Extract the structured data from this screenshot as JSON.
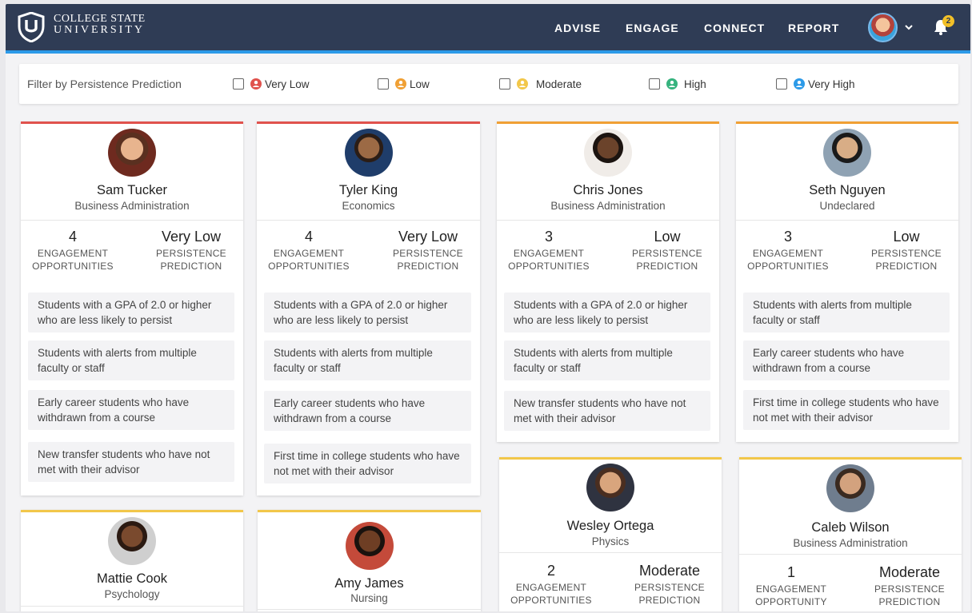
{
  "brand": {
    "line1": "COLLEGE STATE",
    "line2": "UNIVERSITY"
  },
  "nav": {
    "links": [
      "ADVISE",
      "ENGAGE",
      "CONNECT",
      "REPORT"
    ],
    "notification_count": "2"
  },
  "filter": {
    "label": "Filter by Persistence Prediction",
    "options": [
      {
        "label": "Very Low",
        "color": "#e0524d"
      },
      {
        "label": "Low",
        "color": "#f0a035"
      },
      {
        "label": "Moderate",
        "color": "#f2c74a"
      },
      {
        "label": "High",
        "color": "#36b37e"
      },
      {
        "label": "Very High",
        "color": "#2c9ae8"
      }
    ]
  },
  "labels": {
    "engagement_plural": "ENGAGEMENT OPPORTUNITIES",
    "engagement_singular": "ENGAGEMENT OPPORTUNITY",
    "persistence": "PERSISTENCE PREDICTION"
  },
  "students": [
    {
      "name": "Sam Tucker",
      "major": "Business Administration",
      "engagement": "4",
      "engagement_label": "ENGAGEMENT OPPORTUNITIES",
      "prediction": "Very Low",
      "criteria": [
        "Students with a GPA of 2.0 or higher who are less likely to persist",
        "Students with alerts from multiple faculty or staff",
        "Early career students who have withdrawn from a course",
        "New transfer students who have not met with their advisor"
      ]
    },
    {
      "name": "Tyler King",
      "major": "Economics",
      "engagement": "4",
      "engagement_label": "ENGAGEMENT OPPORTUNITIES",
      "prediction": "Very Low",
      "criteria": [
        "Students with a GPA of 2.0 or higher who are less likely to persist",
        "Students with alerts from multiple faculty or staff",
        "Early career students who have withdrawn from a course",
        "First time in college students who have not met with their advisor"
      ]
    },
    {
      "name": "Chris Jones",
      "major": "Business Administration",
      "engagement": "3",
      "engagement_label": "ENGAGEMENT OPPORTUNITIES",
      "prediction": "Low",
      "criteria": [
        "Students with a GPA of 2.0 or higher who are less likely to persist",
        "Students with alerts from multiple faculty or staff",
        "New transfer students who have not met with their advisor"
      ]
    },
    {
      "name": "Seth Nguyen",
      "major": "Undeclared",
      "engagement": "3",
      "engagement_label": "ENGAGEMENT OPPORTUNITIES",
      "prediction": "Low",
      "criteria": [
        "Students with alerts from multiple faculty or staff",
        "Early career students who have withdrawn from a course",
        "First time in college students who have not met with their advisor"
      ]
    },
    {
      "name": "Wesley Ortega",
      "major": "Physics",
      "engagement": "2",
      "engagement_label": "ENGAGEMENT OPPORTUNITIES",
      "prediction": "Moderate",
      "criteria": []
    },
    {
      "name": "Caleb Wilson",
      "major": "Business Administration",
      "engagement": "1",
      "engagement_label": "ENGAGEMENT OPPORTUNITY",
      "prediction": "Moderate",
      "criteria": []
    },
    {
      "name": "Mattie Cook",
      "major": "Psychology",
      "criteria": []
    },
    {
      "name": "Amy James",
      "major": "Nursing",
      "criteria": []
    }
  ]
}
